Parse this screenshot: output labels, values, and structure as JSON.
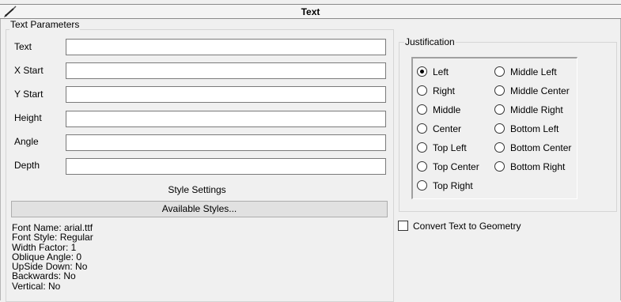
{
  "window": {
    "title": "Text"
  },
  "text_parameters": {
    "legend": "Text Parameters",
    "fields": [
      {
        "label": "Text",
        "value": ""
      },
      {
        "label": "X Start",
        "value": ""
      },
      {
        "label": "Y Start",
        "value": ""
      },
      {
        "label": "Height",
        "value": ""
      },
      {
        "label": "Angle",
        "value": ""
      },
      {
        "label": "Depth",
        "value": ""
      }
    ],
    "style_settings_label": "Style Settings",
    "available_styles_button": "Available Styles...",
    "font_info": [
      "Font Name: arial.ttf",
      "Font Style: Regular",
      "Width Factor: 1",
      "Oblique Angle: 0",
      "UpSide Down: No",
      "Backwards: No",
      "Vertical: No"
    ]
  },
  "justification": {
    "legend": "Justification",
    "selected": "Left",
    "options": [
      "Left",
      "Right",
      "Middle",
      "Center",
      "Top Left",
      "Top Center",
      "Top Right",
      "Middle Left",
      "Middle Center",
      "Middle Right",
      "Bottom Left",
      "Bottom Center",
      "Bottom Right"
    ]
  },
  "convert_to_geometry": {
    "label": "Convert Text to Geometry",
    "checked": false
  }
}
